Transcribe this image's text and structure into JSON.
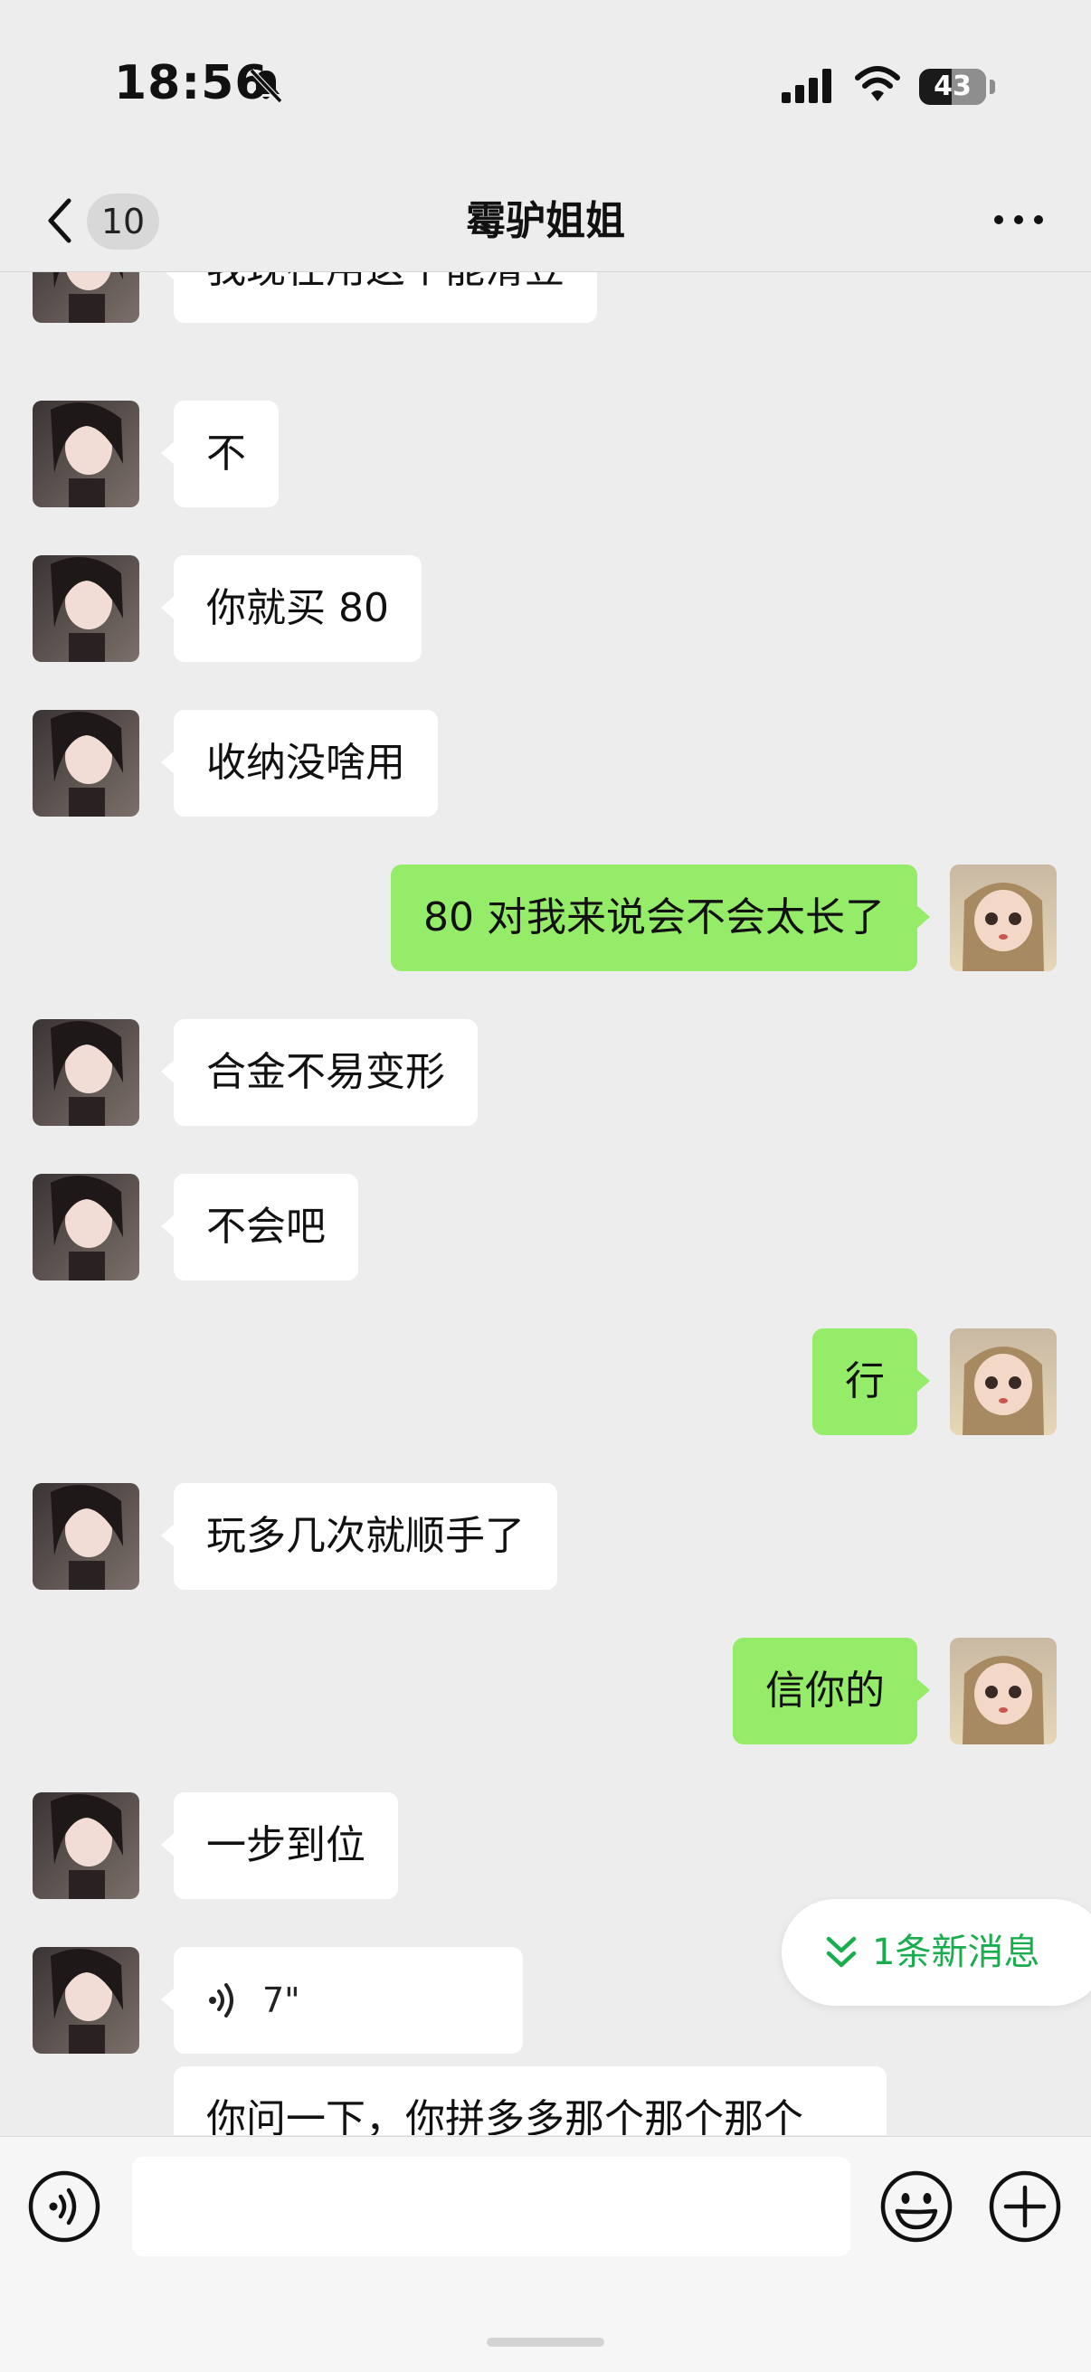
{
  "status_bar": {
    "time": "18:56",
    "battery": "43"
  },
  "header": {
    "unread_count": "10",
    "title": "霉驴姐姐"
  },
  "messages": [
    {
      "side": "in",
      "text": "我现在用这个能滑豆"
    },
    {
      "side": "in",
      "text": "不"
    },
    {
      "side": "in",
      "text": "你就买 80"
    },
    {
      "side": "in",
      "text": "收纳没啥用"
    },
    {
      "side": "out",
      "text": "80 对我来说会不会太长了"
    },
    {
      "side": "in",
      "text": "合金不易变形"
    },
    {
      "side": "in",
      "text": "不会吧"
    },
    {
      "side": "out",
      "text": "行"
    },
    {
      "side": "in",
      "text": "玩多几次就顺手了"
    },
    {
      "side": "out",
      "text": "信你的"
    },
    {
      "side": "in",
      "text": "一步到位"
    },
    {
      "side": "in",
      "type": "voice",
      "text": "7\""
    },
    {
      "side": "in",
      "text": "你问一下，你拼多多那个那个那个"
    }
  ],
  "new_message_banner": "1条新消息",
  "input": {
    "value": "",
    "placeholder": ""
  },
  "colors": {
    "background": "#ededed",
    "outgoing_bubble": "#95ec69",
    "incoming_bubble": "#ffffff",
    "accent_green": "#1aad4e"
  }
}
